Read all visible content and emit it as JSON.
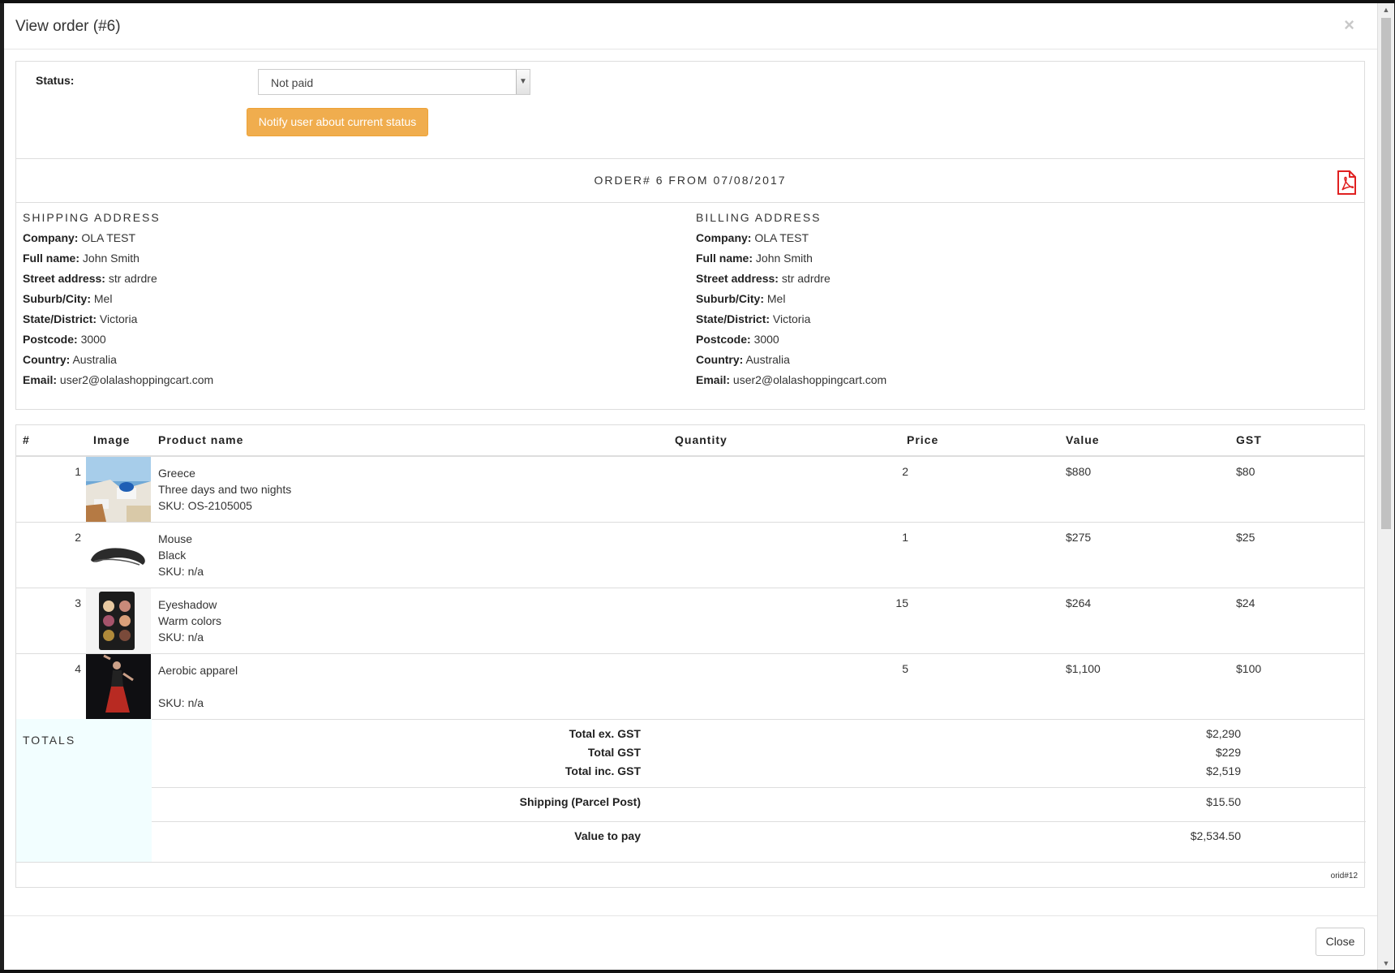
{
  "modal": {
    "title": "View order (#6)",
    "close_glyph": "×",
    "close_label": "Close"
  },
  "status": {
    "label": "Status:",
    "selected": "Not paid",
    "notify_label": "Notify user about current status"
  },
  "order": {
    "title": "ORDER# 6 FROM 07/08/2017"
  },
  "shipping": {
    "title": "SHIPPING ADDRESS",
    "fields": [
      {
        "label": "Company:",
        "value": "OLA TEST"
      },
      {
        "label": "Full name:",
        "value": "John Smith"
      },
      {
        "label": "Street address:",
        "value": "str adrdre"
      },
      {
        "label": "Suburb/City:",
        "value": "Mel"
      },
      {
        "label": "State/District:",
        "value": "Victoria"
      },
      {
        "label": "Postcode:",
        "value": "3000"
      },
      {
        "label": "Country:",
        "value": "Australia"
      },
      {
        "label": "Email:",
        "value": "user2@olalashoppingcart.com"
      }
    ]
  },
  "billing": {
    "title": "BILLING ADDRESS",
    "fields": [
      {
        "label": "Company:",
        "value": "OLA TEST"
      },
      {
        "label": "Full name:",
        "value": "John Smith"
      },
      {
        "label": "Street address:",
        "value": "str adrdre"
      },
      {
        "label": "Suburb/City:",
        "value": "Mel"
      },
      {
        "label": "State/District:",
        "value": "Victoria"
      },
      {
        "label": "Postcode:",
        "value": "3000"
      },
      {
        "label": "Country:",
        "value": "Australia"
      },
      {
        "label": "Email:",
        "value": "user2@olalashoppingcart.com"
      }
    ]
  },
  "table": {
    "headers": {
      "num": "#",
      "image": "Image",
      "product": "Product name",
      "quantity": "Quantity",
      "price": "Price",
      "value": "Value",
      "gst": "GST"
    },
    "rows": [
      {
        "num": "1",
        "name": "Greece",
        "variant": "Three days and two nights",
        "sku": "SKU: OS-2105005",
        "qty": "2",
        "value": "$880",
        "gst": "$80"
      },
      {
        "num": "2",
        "name": "Mouse",
        "variant": "Black",
        "sku": "SKU: n/a",
        "qty": "1",
        "value": "$275",
        "gst": "$25"
      },
      {
        "num": "3",
        "name": "Eyeshadow",
        "variant": "Warm colors",
        "sku": "SKU: n/a",
        "qty": "15",
        "value": "$264",
        "gst": "$24"
      },
      {
        "num": "4",
        "name": "Aerobic apparel",
        "variant": "",
        "sku": "SKU: n/a",
        "qty": "5",
        "value": "$1,100",
        "gst": "$100"
      }
    ]
  },
  "totals": {
    "label": "TOTALS",
    "ex_gst_label": "Total ex. GST",
    "ex_gst": "$2,290",
    "gst_label": "Total GST",
    "gst": "$229",
    "inc_gst_label": "Total inc. GST",
    "inc_gst": "$2,519",
    "shipping_label": "Shipping (Parcel Post)",
    "shipping": "$15.50",
    "pay_label": "Value to pay",
    "pay": "$2,534.50",
    "orid": "orid#12"
  },
  "colors": {
    "notify_button": "#f0ad4e",
    "pdf_icon": "#e02020",
    "totals_bg": "#f2feff"
  },
  "icons": {
    "pdf": "pdf-icon",
    "close": "close-icon",
    "select_arrow": "chevron-down-icon"
  }
}
